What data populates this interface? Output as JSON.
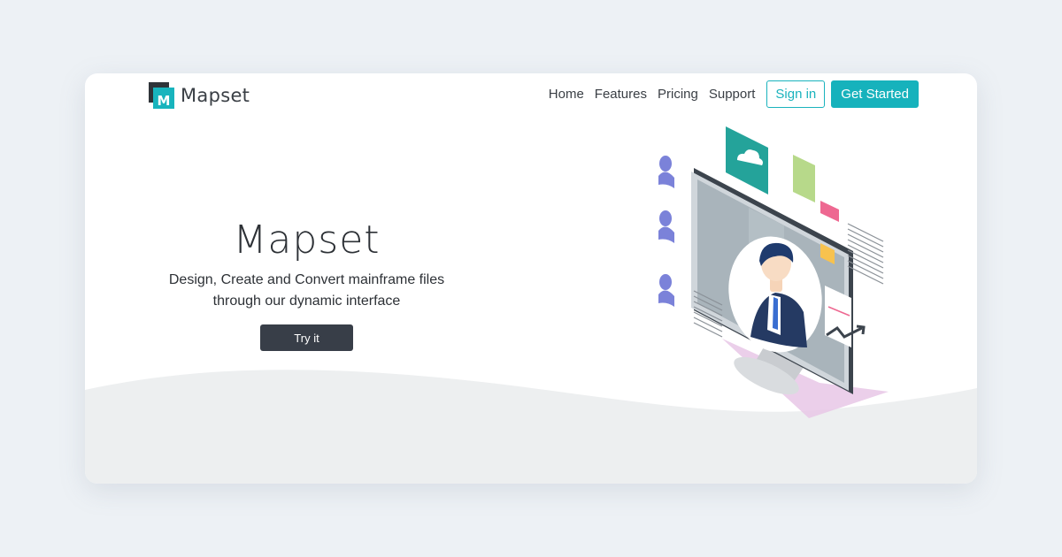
{
  "brand": {
    "name": "Mapset",
    "logo_letter": "M",
    "accent": "#16b2bc"
  },
  "nav": {
    "links": [
      "Home",
      "Features",
      "Pricing",
      "Support"
    ],
    "signin_label": "Sign in",
    "get_started_label": "Get Started"
  },
  "hero": {
    "title": "Mapset",
    "subtitle_line1": "Design, Create and Convert mainframe files",
    "subtitle_line2": "through our dynamic interface",
    "cta_label": "Try it"
  },
  "illustration": {
    "icons": [
      "user-icon",
      "cloud-icon",
      "document-icon",
      "chart-line-icon"
    ]
  }
}
